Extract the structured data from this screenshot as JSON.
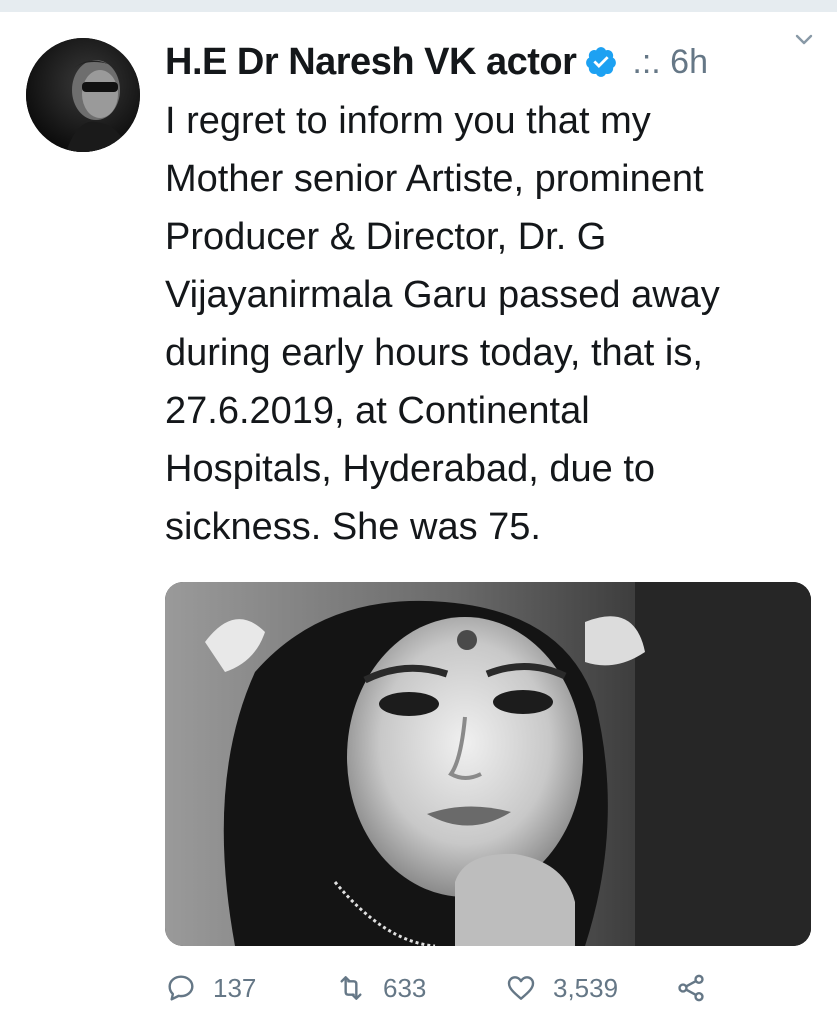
{
  "tweet": {
    "author": {
      "display_name": "H.E Dr Naresh VK actor",
      "verified_icon": "verified-badge-icon"
    },
    "meta": ".:. 6h",
    "text": "I regret to inform you that my\nMother senior Artiste, prominent\nProducer & Director, Dr. G\nVijayanirmala Garu  passed away\nduring early hours today, that is,\n27.6.2019, at Continental\nHospitals, Hyderabad, due to\nsickness. She was 75.",
    "actions": {
      "reply_count": "137",
      "retweet_count": "633",
      "like_count": "3,539"
    }
  },
  "colors": {
    "verified": "#1da1f2",
    "secondary_text": "#657786",
    "primary_text": "#14171a",
    "top_strip": "#e6ecf0"
  }
}
